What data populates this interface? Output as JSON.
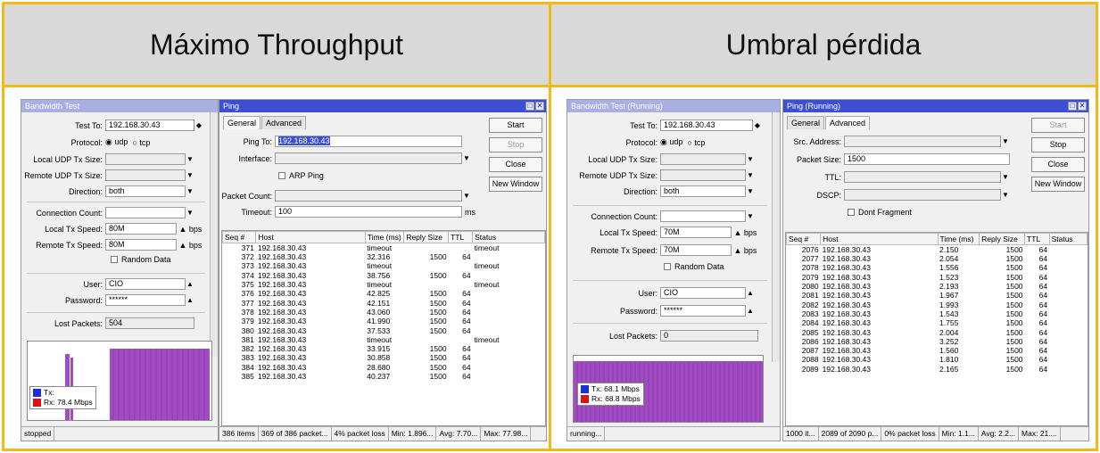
{
  "left_heading": "Máximo Throughput",
  "right_heading": "Umbral pérdida",
  "left": {
    "bw": {
      "title": "Bandwidth Test",
      "test_to_label": "Test To:",
      "test_to": "192.168.30.43",
      "protocol_label": "Protocol:",
      "udp": "udp",
      "tcp": "tcp",
      "local_udp_label": "Local UDP Tx Size:",
      "remote_udp_label": "Remote UDP Tx Size:",
      "direction_label": "Direction:",
      "direction": "both",
      "conn_label": "Connection Count:",
      "local_speed_label": "Local Tx Speed:",
      "local_speed": "80M",
      "bps": "bps",
      "remote_speed_label": "Remote Tx Speed:",
      "remote_speed": "80M",
      "random_label": "Random Data",
      "user_label": "User:",
      "user": "CIO",
      "password_label": "Password:",
      "password": "******",
      "lost_label": "Lost Packets:",
      "lost": "504",
      "tx": "Tx:",
      "rx": "Rx:  78.4 Mbps",
      "status": "stopped"
    },
    "ping": {
      "title": "Ping",
      "tab_general": "General",
      "tab_advanced": "Advanced",
      "ping_to_label": "Ping To:",
      "ping_to": "192.168.30.43",
      "interface_label": "Interface:",
      "arp_label": "ARP Ping",
      "packet_count_label": "Packet Count:",
      "timeout_label": "Timeout:",
      "timeout": "100",
      "ms": "ms",
      "start": "Start",
      "stop": "Stop",
      "close": "Close",
      "new_window": "New Window",
      "columns": [
        "Seq #",
        "Host",
        "Time (ms)",
        "Reply Size",
        "TTL",
        "Status"
      ],
      "rows": [
        [
          "371",
          "192.168.30.43",
          "timeout",
          "",
          "",
          "timeout"
        ],
        [
          "372",
          "192.168.30.43",
          "32.316",
          "1500",
          "64",
          ""
        ],
        [
          "373",
          "192.168.30.43",
          "timeout",
          "",
          "",
          "timeout"
        ],
        [
          "374",
          "192.168.30.43",
          "38.756",
          "1500",
          "64",
          ""
        ],
        [
          "375",
          "192.168.30.43",
          "timeout",
          "",
          "",
          "timeout"
        ],
        [
          "376",
          "192.168.30.43",
          "42.825",
          "1500",
          "64",
          ""
        ],
        [
          "377",
          "192.168.30.43",
          "42.151",
          "1500",
          "64",
          ""
        ],
        [
          "378",
          "192.168.30.43",
          "43.060",
          "1500",
          "64",
          ""
        ],
        [
          "379",
          "192.168.30.43",
          "41.990",
          "1500",
          "64",
          ""
        ],
        [
          "380",
          "192.168.30.43",
          "37.533",
          "1500",
          "64",
          ""
        ],
        [
          "381",
          "192.168.30.43",
          "timeout",
          "",
          "",
          "timeout"
        ],
        [
          "382",
          "192.168.30.43",
          "33.915",
          "1500",
          "64",
          ""
        ],
        [
          "383",
          "192.168.30.43",
          "30.858",
          "1500",
          "64",
          ""
        ],
        [
          "384",
          "192.168.30.43",
          "28.680",
          "1500",
          "64",
          ""
        ],
        [
          "385",
          "192.168.30.43",
          "40.237",
          "1500",
          "64",
          ""
        ]
      ],
      "status": [
        "386 items",
        "369 of 386 packet...",
        "4% packet loss",
        "Min: 1.896...",
        "Avg: 7.70...",
        "Max: 77.98..."
      ]
    }
  },
  "right": {
    "bw": {
      "title": "Bandwidth Test (Running)",
      "test_to_label": "Test To:",
      "test_to": "192.168.30.43",
      "protocol_label": "Protocol:",
      "udp": "udp",
      "tcp": "tcp",
      "local_udp_label": "Local UDP Tx Size:",
      "remote_udp_label": "Remote UDP Tx Size:",
      "direction_label": "Direction:",
      "direction": "both",
      "conn_label": "Connection Count:",
      "local_speed_label": "Local Tx Speed:",
      "local_speed": "70M",
      "bps": "bps",
      "remote_speed_label": "Remote Tx Speed:",
      "remote_speed": "70M",
      "random_label": "Random Data",
      "user_label": "User:",
      "user": "CIO",
      "password_label": "Password:",
      "password": "******",
      "lost_label": "Lost Packets:",
      "lost": "0",
      "tx": "Tx:  68.1 Mbps",
      "rx": "Rx:  68.8 Mbps",
      "status": "running..."
    },
    "ping": {
      "title": "Ping (Running)",
      "tab_general": "General",
      "tab_advanced": "Advanced",
      "src_label": "Src. Address:",
      "packet_size_label": "Packet Size:",
      "packet_size": "1500",
      "ttl_label": "TTL:",
      "dscp_label": "DSCP:",
      "dont_frag_label": "Dont Fragment",
      "start": "Start",
      "stop": "Stop",
      "close": "Close",
      "new_window": "New Window",
      "columns": [
        "Seq #",
        "Host",
        "Time (ms)",
        "Reply Size",
        "TTL",
        "Status"
      ],
      "rows": [
        [
          "2076",
          "192.168.30.43",
          "2.150",
          "1500",
          "64",
          ""
        ],
        [
          "2077",
          "192.168.30.43",
          "2.054",
          "1500",
          "64",
          ""
        ],
        [
          "2078",
          "192.168.30.43",
          "1.556",
          "1500",
          "64",
          ""
        ],
        [
          "2079",
          "192.168.30.43",
          "1.523",
          "1500",
          "64",
          ""
        ],
        [
          "2080",
          "192.168.30.43",
          "2.193",
          "1500",
          "64",
          ""
        ],
        [
          "2081",
          "192.168.30.43",
          "1.967",
          "1500",
          "64",
          ""
        ],
        [
          "2082",
          "192.168.30.43",
          "1.993",
          "1500",
          "64",
          ""
        ],
        [
          "2083",
          "192.168.30.43",
          "1.543",
          "1500",
          "64",
          ""
        ],
        [
          "2084",
          "192.168.30.43",
          "1.755",
          "1500",
          "64",
          ""
        ],
        [
          "2085",
          "192.168.30.43",
          "2.004",
          "1500",
          "64",
          ""
        ],
        [
          "2086",
          "192.168.30.43",
          "3.252",
          "1500",
          "64",
          ""
        ],
        [
          "2087",
          "192.168.30.43",
          "1.560",
          "1500",
          "64",
          ""
        ],
        [
          "2088",
          "192.168.30.43",
          "1.810",
          "1500",
          "64",
          ""
        ],
        [
          "2089",
          "192.168.30.43",
          "2.165",
          "1500",
          "64",
          ""
        ]
      ],
      "status": [
        "1000 it...",
        "2089 of 2090 p...",
        "0% packet loss",
        "Min: 1.1...",
        "Avg: 2.2...",
        "Max: 21...."
      ]
    }
  },
  "colors": {
    "accent": "#f5b915",
    "titlebar": "#3b4fd0",
    "tx": "#1a2ee0",
    "rx": "#e01010",
    "graph": "#a24cc4"
  }
}
